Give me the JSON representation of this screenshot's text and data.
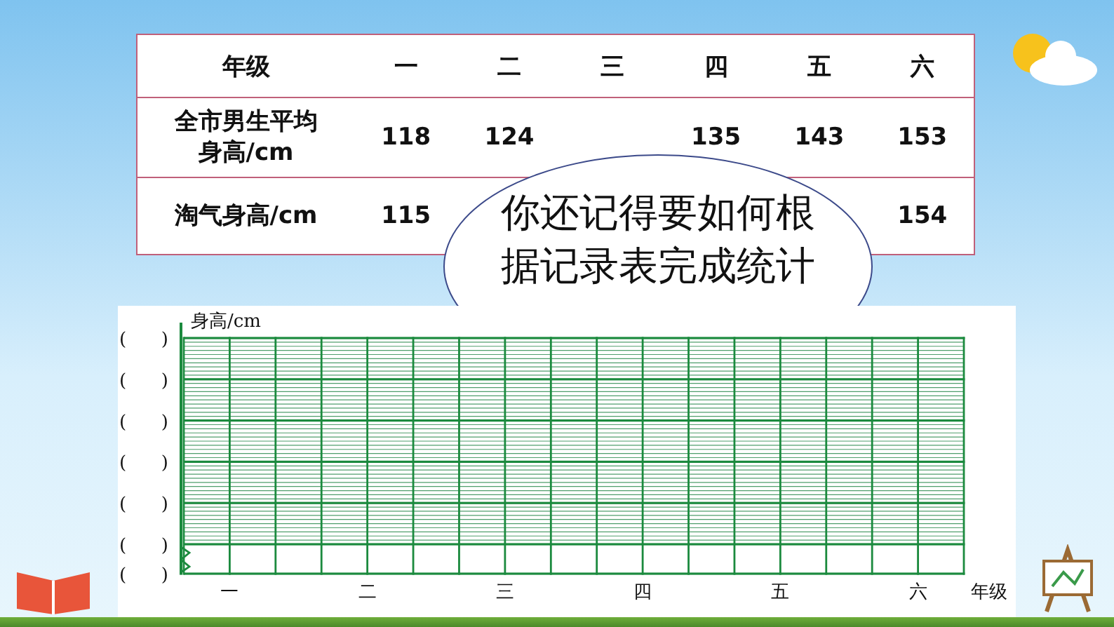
{
  "table": {
    "columns": [
      "年级",
      "一",
      "二",
      "三",
      "四",
      "五",
      "六"
    ],
    "rows": [
      {
        "cells": [
          "全市男生平均身高/cm",
          "118",
          "124",
          null,
          "135",
          "143",
          "153"
        ]
      },
      {
        "cells": [
          "淘气身高/cm",
          "115",
          null,
          null,
          null,
          null,
          "154"
        ]
      }
    ]
  },
  "bubble": {
    "text": "你还记得要如何根据记录表完成统计"
  },
  "chart": {
    "y_title": "身高/cm",
    "y_slots": [
      "(      )",
      "(      )",
      "(      )",
      "(      )",
      "(      )",
      "(      )",
      "(      )"
    ],
    "x_labels": [
      "一",
      "二",
      "三",
      "四",
      "五",
      "六"
    ],
    "x_title": "年级"
  }
}
